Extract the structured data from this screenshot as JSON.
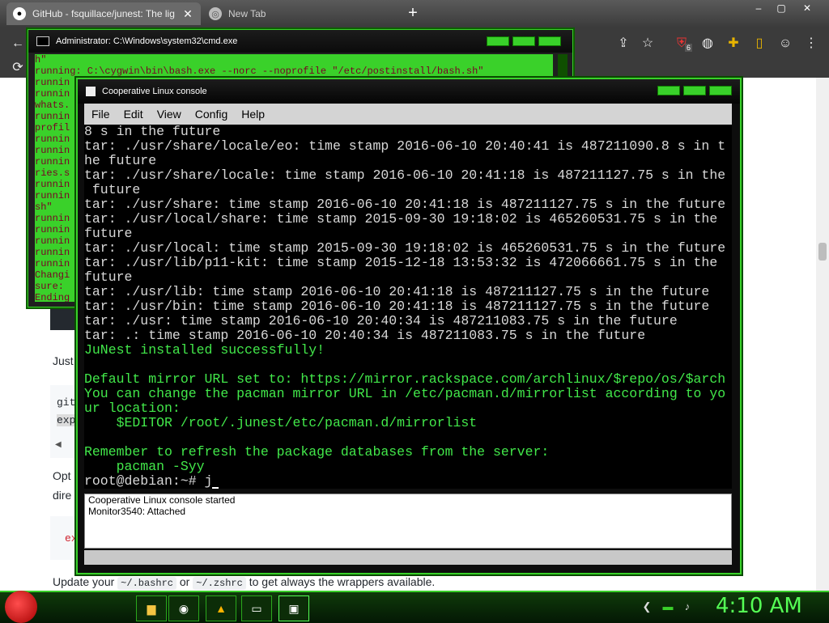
{
  "browser": {
    "tabs": [
      {
        "label": "GitHub - fsquillace/junest: The lig",
        "icon": "github-icon"
      },
      {
        "label": "New Tab",
        "icon": "chrome-icon"
      }
    ],
    "new_tab_symbol": "+",
    "window_controls": [
      "–",
      "▢",
      "✕"
    ],
    "toolbar_icons": [
      "back-icon",
      "share-icon",
      "star-icon",
      "extension-ublock-icon",
      "extension-globe-icon",
      "puzzle-icon",
      "sidebar-icon",
      "profile-icon",
      "menu-icon"
    ],
    "ublock_badge": "6"
  },
  "webpage": {
    "just_text": "Just",
    "git_text": "git",
    "exp_text": "exp",
    "opt_text": "Opt",
    "dire_text": "dire",
    "ex_text": "ex",
    "update_line": {
      "prefix": "Update your",
      "chip1": "~/.bashrc",
      "or": "or",
      "chip2": "~/.zshrc",
      "suffix": "to get always the wrappers available."
    }
  },
  "cmd": {
    "title": "Administrator: C:\\Windows\\system32\\cmd.exe",
    "lines": [
      "h\"",
      "running: C:\\cygwin\\bin\\bash.exe --norc --noprofile \"/etc/postinstall/bash.sh\"",
      "runnin",
      "runnin",
      "whats.",
      "runnin",
      "profil",
      "runnin",
      "",
      "runnin",
      "runnin",
      "ries.s",
      "runnin",
      "",
      "runnin",
      "sh\"",
      "runnin",
      "",
      "runnin",
      "runnin",
      "runnin",
      "runnin",
      "Changi",
      "sure:",
      "Ending"
    ]
  },
  "colinux": {
    "title": "Cooperative Linux console",
    "menu": [
      "File",
      "Edit",
      "View",
      "Config",
      "Help"
    ],
    "terminal_lines": [
      {
        "text": "8 s in the future",
        "style": "plain"
      },
      {
        "text": "tar: ./usr/share/locale/eo: time stamp 2016-06-10 20:40:41 is 487211090.8 s in t",
        "style": "plain"
      },
      {
        "text": "he future",
        "style": "plain"
      },
      {
        "text": "tar: ./usr/share/locale: time stamp 2016-06-10 20:41:18 is 487211127.75 s in the",
        "style": "plain"
      },
      {
        "text": " future",
        "style": "plain"
      },
      {
        "text": "tar: ./usr/share: time stamp 2016-06-10 20:41:18 is 487211127.75 s in the future",
        "style": "plain"
      },
      {
        "text": "tar: ./usr/local/share: time stamp 2015-09-30 19:18:02 is 465260531.75 s in the",
        "style": "plain"
      },
      {
        "text": "future",
        "style": "plain"
      },
      {
        "text": "tar: ./usr/local: time stamp 2015-09-30 19:18:02 is 465260531.75 s in the future",
        "style": "plain"
      },
      {
        "text": "tar: ./usr/lib/p11-kit: time stamp 2015-12-18 13:53:32 is 472066661.75 s in the",
        "style": "plain"
      },
      {
        "text": "future",
        "style": "plain"
      },
      {
        "text": "tar: ./usr/lib: time stamp 2016-06-10 20:41:18 is 487211127.75 s in the future",
        "style": "plain"
      },
      {
        "text": "tar: ./usr/bin: time stamp 2016-06-10 20:41:18 is 487211127.75 s in the future",
        "style": "plain"
      },
      {
        "text": "tar: ./usr: time stamp 2016-06-10 20:40:34 is 487211083.75 s in the future",
        "style": "plain"
      },
      {
        "text": "tar: .: time stamp 2016-06-10 20:40:34 is 487211083.75 s in the future",
        "style": "plain"
      },
      {
        "text": "JuNest installed successfully!",
        "style": "green"
      },
      {
        "text": "",
        "style": "plain"
      },
      {
        "text": "Default mirror URL set to: https://mirror.rackspace.com/archlinux/$repo/os/$arch",
        "style": "green"
      },
      {
        "text": "You can change the pacman mirror URL in /etc/pacman.d/mirrorlist according to yo",
        "style": "green"
      },
      {
        "text": "ur location:",
        "style": "green"
      },
      {
        "text": "    $EDITOR /root/.junest/etc/pacman.d/mirrorlist",
        "style": "green"
      },
      {
        "text": "",
        "style": "plain"
      },
      {
        "text": "Remember to refresh the package databases from the server:",
        "style": "green"
      },
      {
        "text": "    pacman -Syy",
        "style": "green"
      }
    ],
    "prompt": "root@debian:~# j",
    "log": [
      "Cooperative Linux console started",
      "Monitor3540: Attached"
    ]
  },
  "taskbar": {
    "buttons": [
      "folder-icon",
      "chrome-icon",
      "colorful-app-icon",
      "cmd-icon",
      "colinux-icon"
    ],
    "clock": "4:10 AM",
    "tray_icons": [
      "back-arrow-icon",
      "network-icon",
      "volume-icon"
    ]
  },
  "colors": {
    "accent_green": "#39d12a",
    "terminal_green": "#42e84a",
    "clock_green": "#55ff55"
  }
}
